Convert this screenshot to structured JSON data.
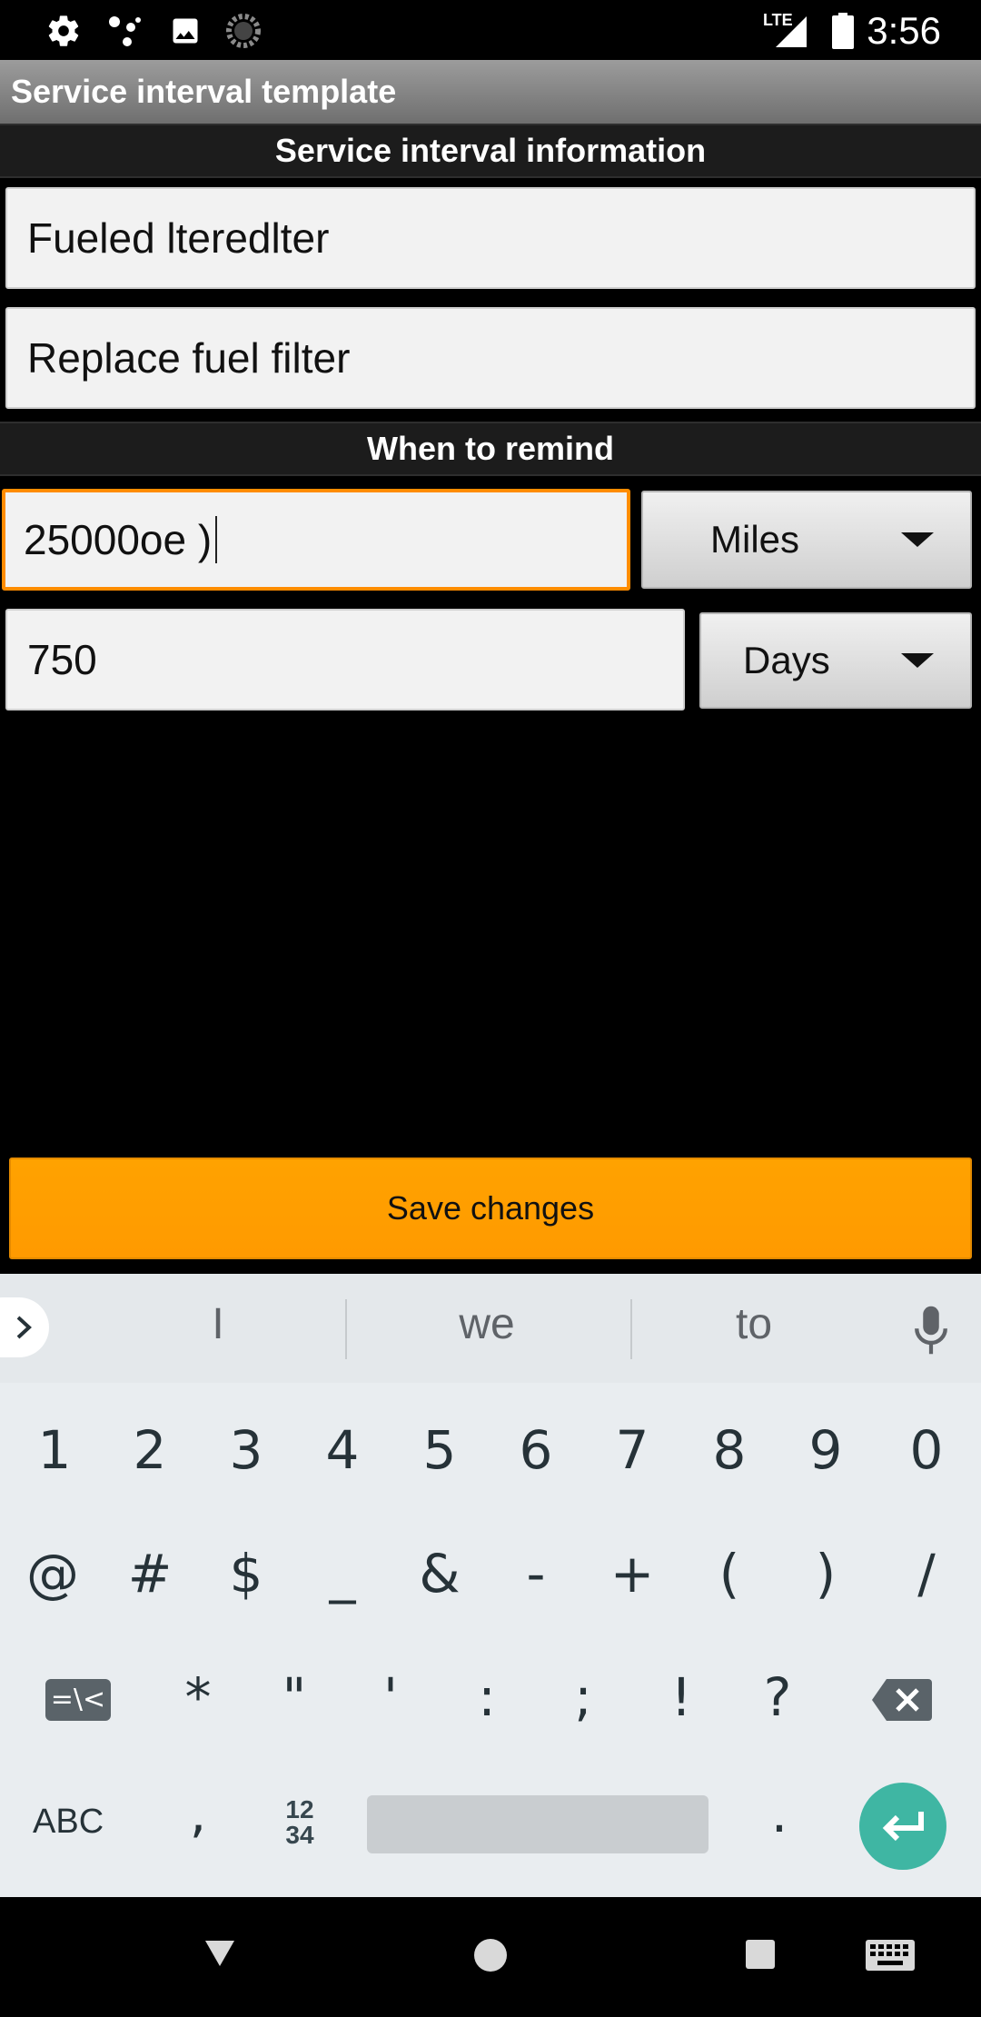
{
  "status_bar": {
    "time": "3:56",
    "network": "LTE",
    "icons": [
      "settings-icon",
      "assistant-dots-icon",
      "image-icon",
      "sync-circle-icon",
      "signal-icon",
      "battery-icon"
    ]
  },
  "app": {
    "title": "Service interval template"
  },
  "info_section": {
    "header": "Service interval information",
    "name_value": "Fueled lteredlter",
    "description_value": "Replace fuel filter"
  },
  "remind_section": {
    "header": "When to remind",
    "distance_value": "25000oe )",
    "distance_unit": "Miles",
    "time_value": "750",
    "time_unit": "Days"
  },
  "save_button": {
    "label": "Save changes"
  },
  "keyboard": {
    "suggestions": [
      "I",
      "we",
      "to"
    ],
    "row1": [
      "1",
      "2",
      "3",
      "4",
      "5",
      "6",
      "7",
      "8",
      "9",
      "0"
    ],
    "row2": [
      "@",
      "#",
      "$",
      "_",
      "&",
      "-",
      "+",
      "(",
      ")",
      "/"
    ],
    "row3": [
      "*",
      "\"",
      "'",
      ":",
      ";",
      "!",
      "?"
    ],
    "symbols_key": "=\\<",
    "abc_key": "ABC",
    "comma_key": ",",
    "numpad_key_top": "12",
    "numpad_key_bottom": "34",
    "period_key": "."
  },
  "colors": {
    "accent": "#ff9a00",
    "enter_key": "#3fb6a3",
    "section_header": "#1c1c1c"
  }
}
